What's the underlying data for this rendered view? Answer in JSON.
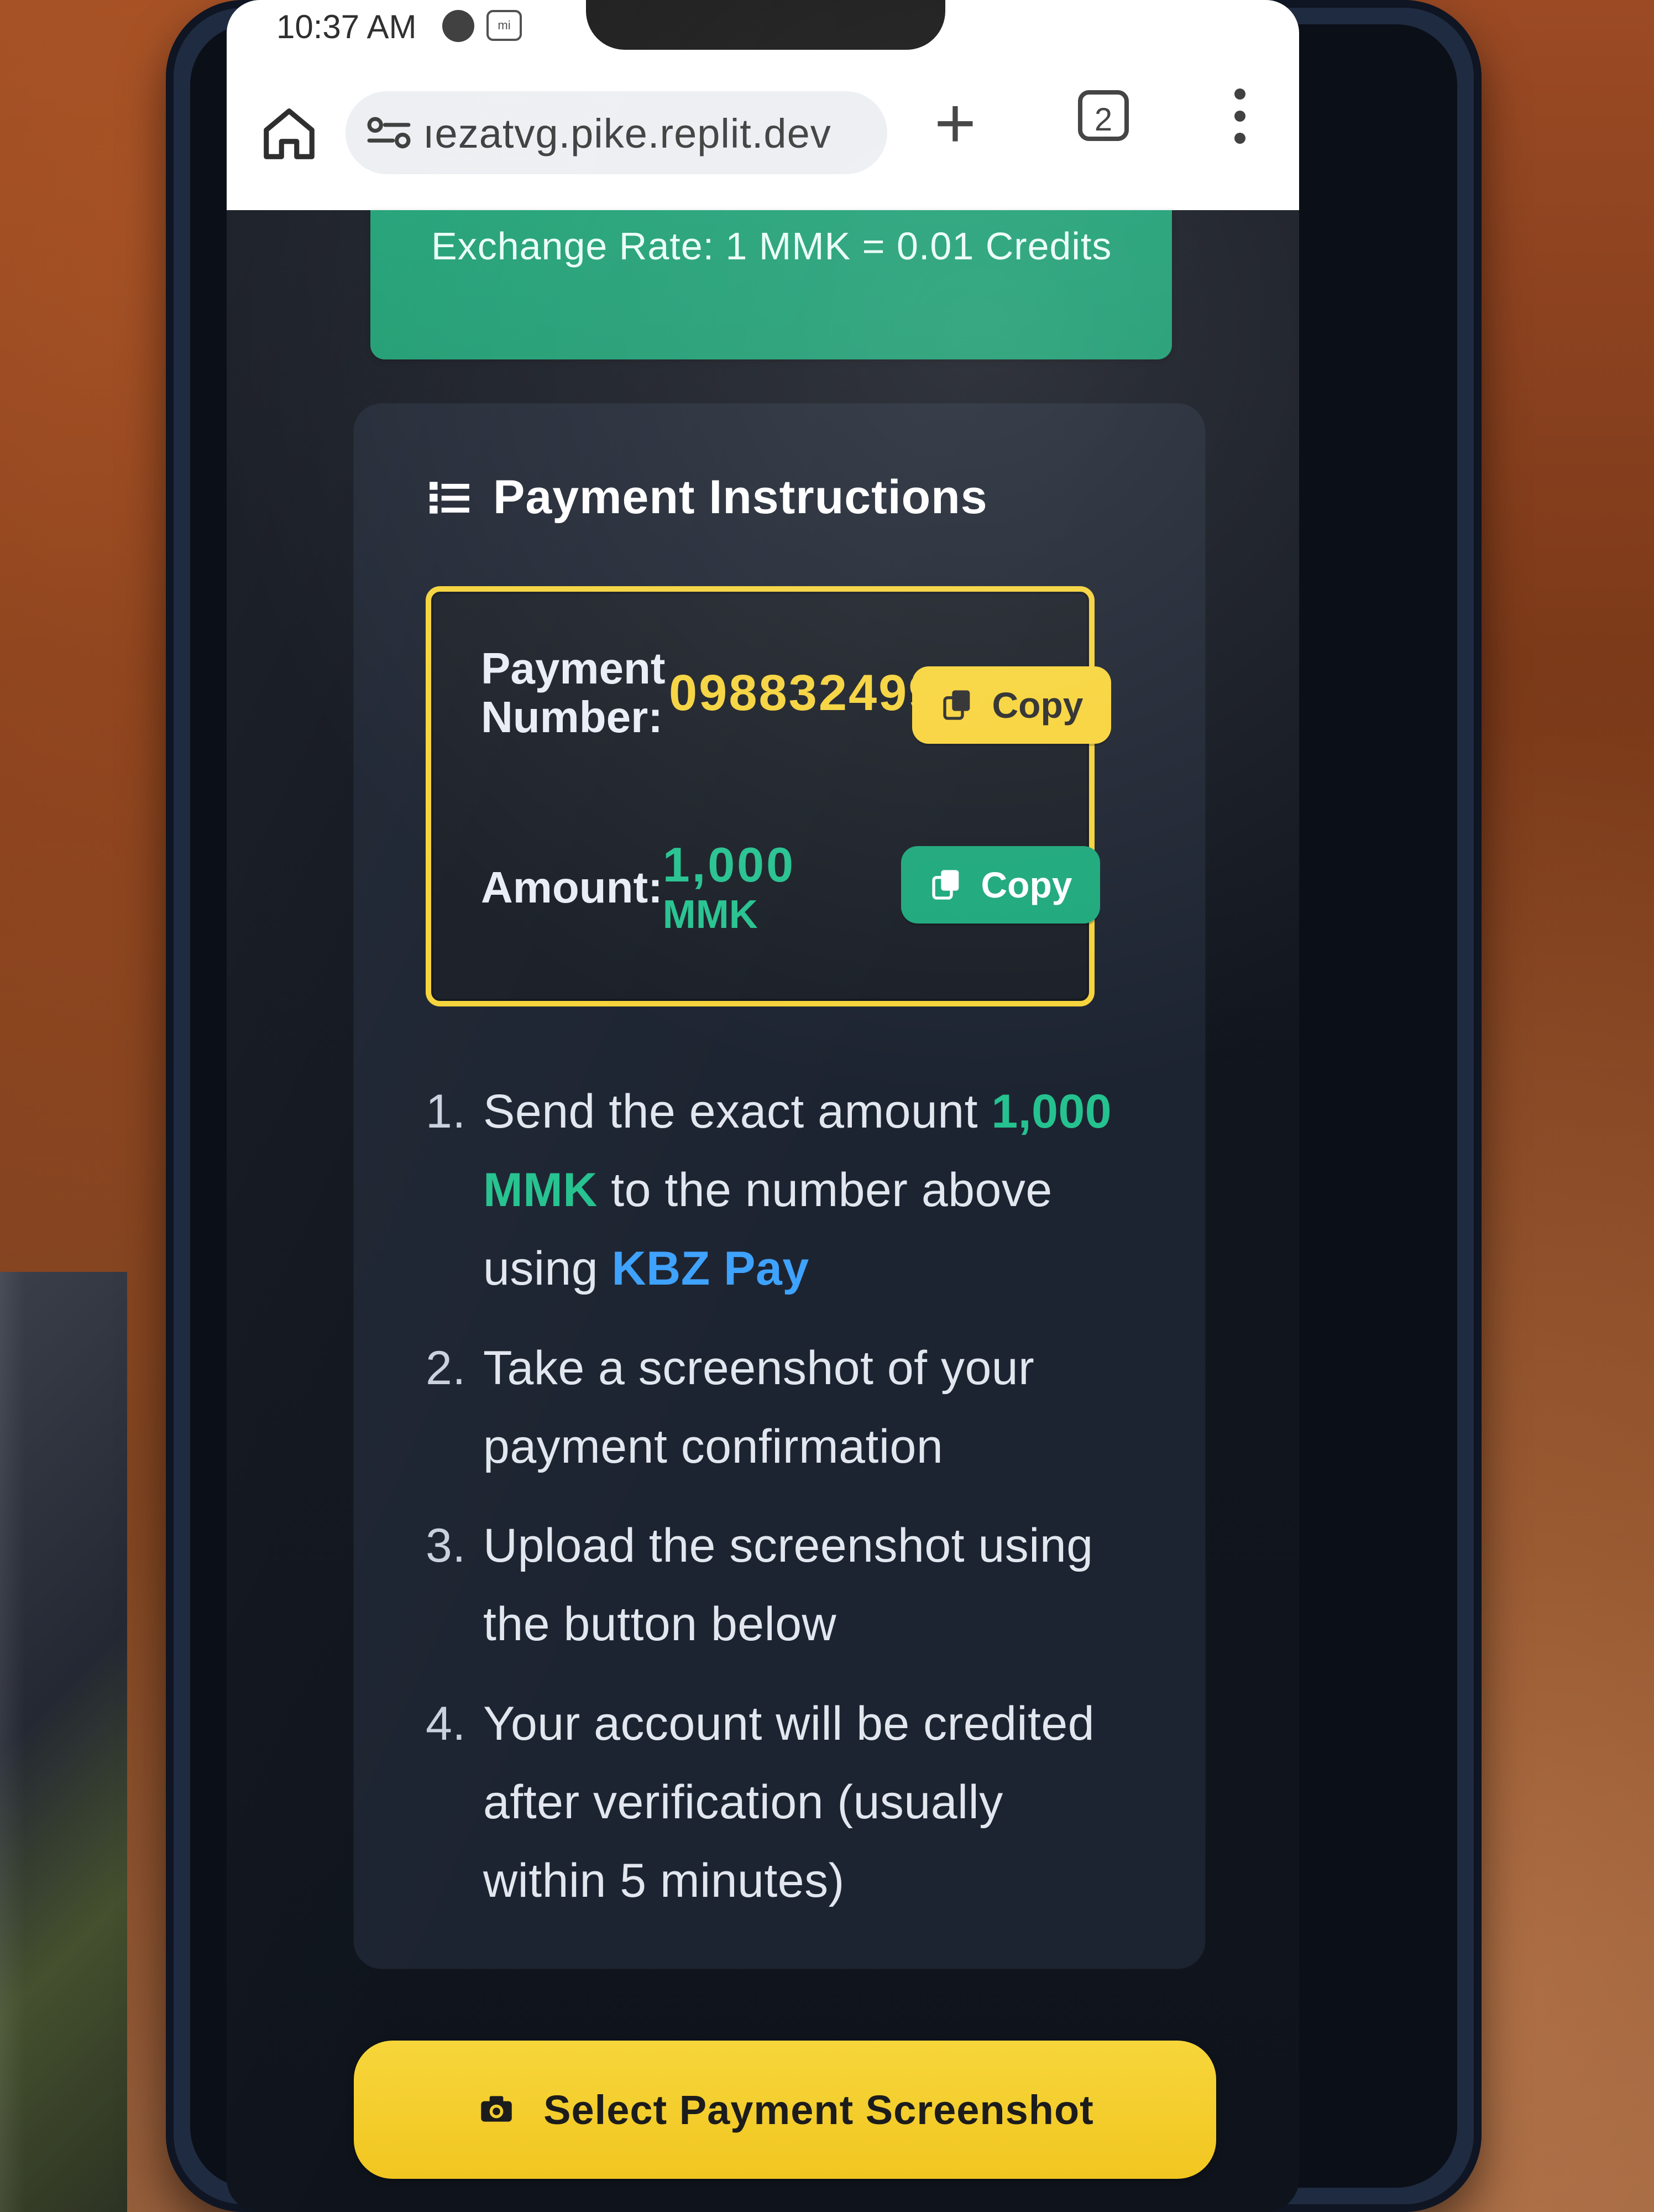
{
  "status_bar": {
    "time": "10:37 AM",
    "sync_icon": "sync-icon",
    "mi_icon": "mi-icon",
    "mi_label": "mi"
  },
  "browser": {
    "home_icon": "home-icon",
    "site_icon": "site-settings-icon",
    "url": "ıezatvg.pike.replit.dev",
    "new_tab_icon": "plus-icon",
    "tabs_count": "2",
    "menu_icon": "more-vert-icon"
  },
  "page": {
    "exchange_rate": "Exchange Rate: 1 MMK = 0.01 Credits",
    "instructions": {
      "icon": "list-icon",
      "title": "Payment Instructions",
      "payment_number_label": "Payment Number:",
      "payment_number_value": "09883249943",
      "copy_label": "Copy",
      "amount_label": "Amount:",
      "amount_value": "1,000",
      "amount_unit": "MMK",
      "steps": [
        {
          "num": "1.",
          "pre": "Send the exact amount ",
          "highlight": "1,000 MMK",
          "post": " to the number above using ",
          "service": "KBZ Pay"
        },
        {
          "num": "2.",
          "text": "Take a screenshot of your payment confirmation"
        },
        {
          "num": "3.",
          "text": "Upload the screenshot using the button below"
        },
        {
          "num": "4.",
          "text": "Your account will be credited after verification (usually within 5 minutes)"
        }
      ]
    },
    "select_button": {
      "icon": "camera-icon",
      "label": "Select Payment Screenshot"
    }
  },
  "colors": {
    "accent_green": "#1da87b",
    "accent_yellow": "#f8d43b",
    "accent_blue": "#3ea2ff",
    "background_dark": "#0f141c"
  }
}
